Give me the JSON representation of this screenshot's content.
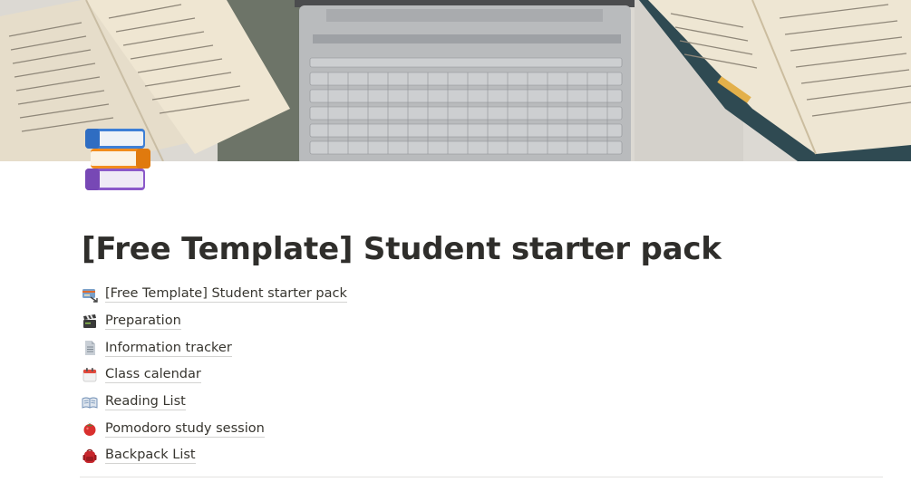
{
  "page": {
    "title": "[Free Template] Student starter pack",
    "page_icon": "books-icon",
    "cover": "laptop-and-open-books-photo"
  },
  "links": [
    {
      "label": "[Free Template] Student starter pack",
      "icon": "gift-card-icon"
    },
    {
      "label": "Preparation",
      "icon": "clapper-board-icon"
    },
    {
      "label": "Information tracker",
      "icon": "document-icon"
    },
    {
      "label": "Class calendar",
      "icon": "calendar-icon"
    },
    {
      "label": "Reading List",
      "icon": "open-book-icon"
    },
    {
      "label": "Pomodoro study session",
      "icon": "tomato-icon"
    },
    {
      "label": "Backpack List",
      "icon": "backpack-icon"
    }
  ],
  "colors": {
    "text": "#37352f",
    "underline": "#d3d2cf",
    "divider": "#e3e2e0"
  }
}
